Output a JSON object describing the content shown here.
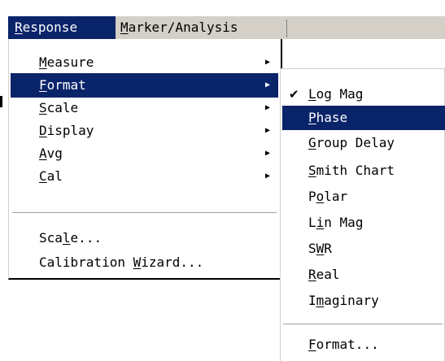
{
  "menubar": {
    "items": [
      {
        "mnemonic": "R",
        "rest": "esponse"
      },
      {
        "mnemonic": "M",
        "rest": "arker/Analysis"
      }
    ]
  },
  "response_menu": {
    "items": [
      {
        "pre": "",
        "mnemonic": "M",
        "rest": "easure",
        "submenu": true,
        "highlighted": false
      },
      {
        "pre": "",
        "mnemonic": "F",
        "rest": "ormat",
        "submenu": true,
        "highlighted": true
      },
      {
        "pre": "",
        "mnemonic": "S",
        "rest": "cale",
        "submenu": true,
        "highlighted": false
      },
      {
        "pre": "",
        "mnemonic": "D",
        "rest": "isplay",
        "submenu": true,
        "highlighted": false
      },
      {
        "pre": "",
        "mnemonic": "A",
        "rest": "vg",
        "submenu": true,
        "highlighted": false
      },
      {
        "pre": "",
        "mnemonic": "C",
        "rest": "al",
        "submenu": true,
        "highlighted": false
      }
    ],
    "items_after_separator": [
      {
        "pre": "Sca",
        "mnemonic": "l",
        "rest": "e..."
      },
      {
        "pre": "Calibration ",
        "mnemonic": "W",
        "rest": "izard..."
      }
    ],
    "arrow_glyph": "▶"
  },
  "format_menu": {
    "check_glyph": "✔",
    "items": [
      {
        "pre": "",
        "mnemonic": "L",
        "rest": "og Mag",
        "checked": true,
        "highlighted": false
      },
      {
        "pre": "",
        "mnemonic": "P",
        "rest": "hase",
        "checked": false,
        "highlighted": true
      },
      {
        "pre": "",
        "mnemonic": "G",
        "rest": "roup Delay",
        "checked": false,
        "highlighted": false
      },
      {
        "pre": "",
        "mnemonic": "S",
        "rest": "mith Chart",
        "checked": false,
        "highlighted": false
      },
      {
        "pre": "P",
        "mnemonic": "o",
        "rest": "lar",
        "checked": false,
        "highlighted": false
      },
      {
        "pre": "L",
        "mnemonic": "i",
        "rest": "n Mag",
        "checked": false,
        "highlighted": false
      },
      {
        "pre": "S",
        "mnemonic": "W",
        "rest": "R",
        "checked": false,
        "highlighted": false
      },
      {
        "pre": "",
        "mnemonic": "R",
        "rest": "eal",
        "checked": false,
        "highlighted": false
      },
      {
        "pre": "I",
        "mnemonic": "m",
        "rest": "aginary",
        "checked": false,
        "highlighted": false
      }
    ],
    "items_after_separator": [
      {
        "pre": "",
        "mnemonic": "F",
        "rest": "ormat..."
      }
    ]
  },
  "colors": {
    "highlight": "#0a246a",
    "menubar": "#d4d0c8"
  }
}
